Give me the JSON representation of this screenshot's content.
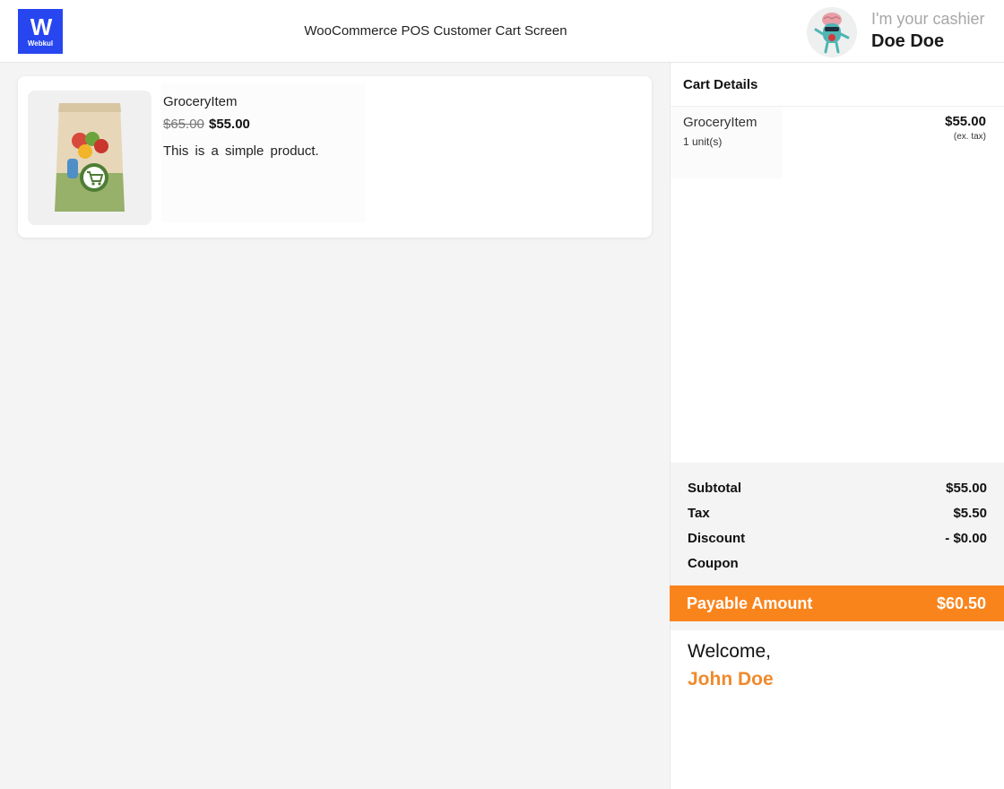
{
  "header": {
    "logo_text": "Webkul",
    "title": "WooCommerce POS Customer Cart Screen",
    "cashier_label": "I'm your cashier",
    "cashier_name": "Doe Doe"
  },
  "product": {
    "name": "GroceryItem",
    "regular_price": "$65.00",
    "sale_price": "$55.00",
    "description": "This is a simple product.",
    "image_icon": "grocery-bag-icon"
  },
  "cart": {
    "title": "Cart Details",
    "items": [
      {
        "name": "GroceryItem",
        "quantity": "1 unit(s)",
        "price": "$55.00",
        "tax_note": "(ex. tax)"
      }
    ]
  },
  "totals": {
    "subtotal_label": "Subtotal",
    "subtotal_value": "$55.00",
    "tax_label": "Tax",
    "tax_value": "$5.50",
    "discount_label": "Discount",
    "discount_value": "- $0.00",
    "coupon_label": "Coupon"
  },
  "payable": {
    "label": "Payable Amount",
    "value": "$60.50"
  },
  "welcome": {
    "greeting": "Welcome,",
    "customer_name": "John Doe"
  },
  "colors": {
    "brand_blue": "#2746f0",
    "accent_orange": "#fa841c",
    "customer_name_orange": "#f08a2c"
  }
}
